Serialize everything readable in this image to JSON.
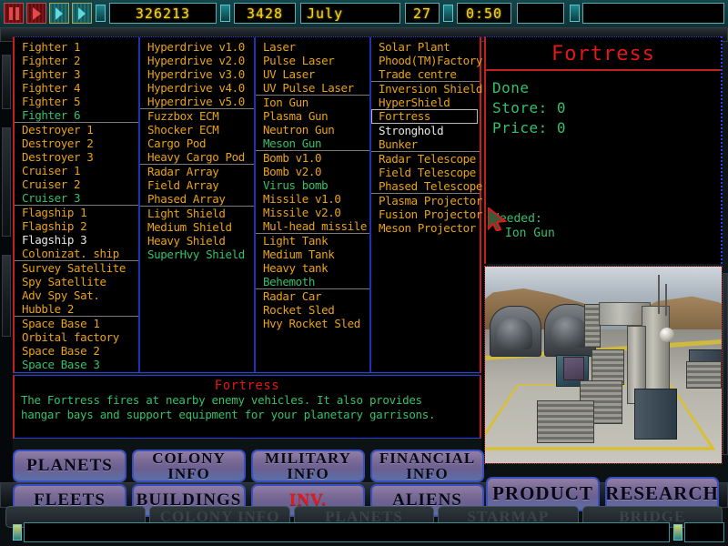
{
  "topbar": {
    "controls": [
      {
        "name": "pause-button",
        "glyph": "pause"
      },
      {
        "name": "play-button",
        "glyph": "arrow-red"
      },
      {
        "name": "fast-forward-button",
        "glyph": "double-arrow"
      },
      {
        "name": "fastest-forward-button",
        "glyph": "double-arrow"
      }
    ],
    "credits": "326213",
    "population": "3428",
    "month": "July",
    "day": "27",
    "clock": "0:50",
    "message": ""
  },
  "columns": [
    {
      "name": "ships-column",
      "groups": [
        {
          "items": [
            {
              "label": "Fighter 1",
              "state": "available"
            },
            {
              "label": "Fighter 2",
              "state": "available"
            },
            {
              "label": "Fighter 3",
              "state": "available"
            },
            {
              "label": "Fighter 4",
              "state": "available"
            },
            {
              "label": "Fighter 5",
              "state": "available"
            },
            {
              "label": "Fighter 6",
              "state": "researching"
            }
          ]
        },
        {
          "items": [
            {
              "label": "Destroyer 1",
              "state": "available"
            },
            {
              "label": "Destroyer 2",
              "state": "available"
            },
            {
              "label": "Destroyer 3",
              "state": "available"
            },
            {
              "label": "Cruiser 1",
              "state": "available"
            },
            {
              "label": "Cruiser 2",
              "state": "available"
            },
            {
              "label": "Cruiser 3",
              "state": "researching"
            }
          ]
        },
        {
          "items": [
            {
              "label": "Flagship 1",
              "state": "available"
            },
            {
              "label": "Flagship 2",
              "state": "available"
            },
            {
              "label": "Flagship 3",
              "state": "locked"
            },
            {
              "label": "Colonizat. ship",
              "state": "available"
            }
          ]
        },
        {
          "items": [
            {
              "label": "Survey Satellite",
              "state": "available"
            },
            {
              "label": "Spy Satellite",
              "state": "available"
            },
            {
              "label": "Adv Spy Sat.",
              "state": "available"
            },
            {
              "label": "Hubble 2",
              "state": "available"
            }
          ]
        },
        {
          "items": [
            {
              "label": "Space Base 1",
              "state": "available"
            },
            {
              "label": "Orbital factory",
              "state": "available"
            },
            {
              "label": "Space Base 2",
              "state": "available"
            },
            {
              "label": "Space Base 3",
              "state": "researching"
            }
          ]
        }
      ]
    },
    {
      "name": "components-column",
      "groups": [
        {
          "items": [
            {
              "label": "Hyperdrive v1.0",
              "state": "available"
            },
            {
              "label": "Hyperdrive v2.0",
              "state": "available"
            },
            {
              "label": "Hyperdrive v3.0",
              "state": "available"
            },
            {
              "label": "Hyperdrive v4.0",
              "state": "available"
            },
            {
              "label": "Hyperdrive v5.0",
              "state": "available"
            }
          ]
        },
        {
          "items": [
            {
              "label": "Fuzzbox ECM",
              "state": "available"
            },
            {
              "label": "Shocker ECM",
              "state": "available"
            },
            {
              "label": "Cargo Pod",
              "state": "available"
            },
            {
              "label": "Heavy Cargo Pod",
              "state": "available"
            }
          ]
        },
        {
          "items": [
            {
              "label": "Radar Array",
              "state": "available"
            },
            {
              "label": "Field Array",
              "state": "available"
            },
            {
              "label": "Phased Array",
              "state": "available"
            }
          ]
        },
        {
          "items": [
            {
              "label": "Light Shield",
              "state": "available"
            },
            {
              "label": "Medium Shield",
              "state": "available"
            },
            {
              "label": "Heavy Shield",
              "state": "available"
            },
            {
              "label": "SuperHvy Shield",
              "state": "researching"
            }
          ]
        }
      ]
    },
    {
      "name": "weapons-column",
      "groups": [
        {
          "items": [
            {
              "label": "Laser",
              "state": "available"
            },
            {
              "label": "Pulse Laser",
              "state": "available"
            },
            {
              "label": "UV Laser",
              "state": "available"
            },
            {
              "label": "UV Pulse Laser",
              "state": "available"
            }
          ]
        },
        {
          "items": [
            {
              "label": "Ion Gun",
              "state": "available"
            },
            {
              "label": "Plasma Gun",
              "state": "available"
            },
            {
              "label": "Neutron Gun",
              "state": "available"
            },
            {
              "label": "Meson Gun",
              "state": "researching"
            }
          ]
        },
        {
          "items": [
            {
              "label": "Bomb v1.0",
              "state": "available"
            },
            {
              "label": "Bomb v2.0",
              "state": "available"
            },
            {
              "label": "Virus bomb",
              "state": "researching"
            },
            {
              "label": "Missile v1.0",
              "state": "available"
            },
            {
              "label": "Missile v2.0",
              "state": "available"
            },
            {
              "label": "Mul-head missile",
              "state": "available"
            }
          ]
        },
        {
          "items": [
            {
              "label": "Light Tank",
              "state": "available"
            },
            {
              "label": "Medium Tank",
              "state": "available"
            },
            {
              "label": "Heavy tank",
              "state": "available"
            },
            {
              "label": "Behemoth",
              "state": "researching"
            }
          ]
        },
        {
          "items": [
            {
              "label": "Radar Car",
              "state": "available"
            },
            {
              "label": "Rocket Sled",
              "state": "available"
            },
            {
              "label": "Hvy Rocket Sled",
              "state": "available"
            }
          ]
        }
      ]
    },
    {
      "name": "buildings-column",
      "groups": [
        {
          "items": [
            {
              "label": "Solar Plant",
              "state": "available"
            },
            {
              "label": "Phood(TM)Factory",
              "state": "available"
            },
            {
              "label": "Trade centre",
              "state": "available"
            }
          ]
        },
        {
          "items": [
            {
              "label": "Inversion Shield",
              "state": "available"
            },
            {
              "label": "HyperShield",
              "state": "available"
            },
            {
              "label": "Fortress",
              "state": "selected"
            },
            {
              "label": "Stronghold",
              "state": "locked"
            },
            {
              "label": "Bunker",
              "state": "available"
            }
          ]
        },
        {
          "items": [
            {
              "label": "Radar Telescope",
              "state": "available"
            },
            {
              "label": "Field Telescope",
              "state": "available"
            },
            {
              "label": "Phased Telescope",
              "state": "available"
            }
          ]
        },
        {
          "items": [
            {
              "label": "Plasma Projector",
              "state": "available"
            },
            {
              "label": "Fusion Projector",
              "state": "available"
            },
            {
              "label": "Meson Projector",
              "state": "available"
            }
          ]
        }
      ]
    }
  ],
  "description": {
    "title": "Fortress",
    "line1": "The Fortress fires at nearby enemy vehicles. It also provides",
    "line2": "hangar bays and support equipment for your planetary garrisons."
  },
  "info": {
    "title": "Fortress",
    "status": "Done",
    "store_label": "Store: 0",
    "price_label": "Price: 0",
    "needed_label": "Needed:",
    "needed_item": "Ion Gun"
  },
  "buttons": {
    "row1": [
      {
        "name": "planets-button",
        "label": "PLANETS",
        "active": false
      },
      {
        "name": "colony-info-button",
        "label": "COLONY\nINFO",
        "active": false
      },
      {
        "name": "military-info-button",
        "label": "MILITARY\nINFO",
        "active": false
      },
      {
        "name": "financial-info-button",
        "label": "FINANCIAL\nINFO",
        "active": false
      }
    ],
    "row2": [
      {
        "name": "fleets-button",
        "label": "FLEETS",
        "active": false
      },
      {
        "name": "buildings-button",
        "label": "BUILDINGS",
        "active": false
      },
      {
        "name": "inventory-button",
        "label": "INV.",
        "active": true
      },
      {
        "name": "aliens-button",
        "label": "ALIENS",
        "active": false
      }
    ],
    "right": [
      {
        "name": "product-button",
        "label": "PRODUCT",
        "active": false
      },
      {
        "name": "research-button",
        "label": "RESEARCH",
        "active": false
      }
    ],
    "background_row": [
      {
        "name": "bg-button-1",
        "label": ""
      },
      {
        "name": "bg-button-colony-info",
        "label": "COLONY INFO"
      },
      {
        "name": "bg-button-planets",
        "label": "PLANETS"
      },
      {
        "name": "bg-button-starmap",
        "label": "STARMAP"
      },
      {
        "name": "bg-button-bridge",
        "label": "BRIDGE"
      }
    ]
  },
  "colors": {
    "available": "#e8a318",
    "researching": "#35c06a",
    "locked": "#e8e8e8",
    "title": "#e01818",
    "lcd": "#f5d419",
    "border_red": "#c02020",
    "border_blue": "#2a3fe0"
  }
}
